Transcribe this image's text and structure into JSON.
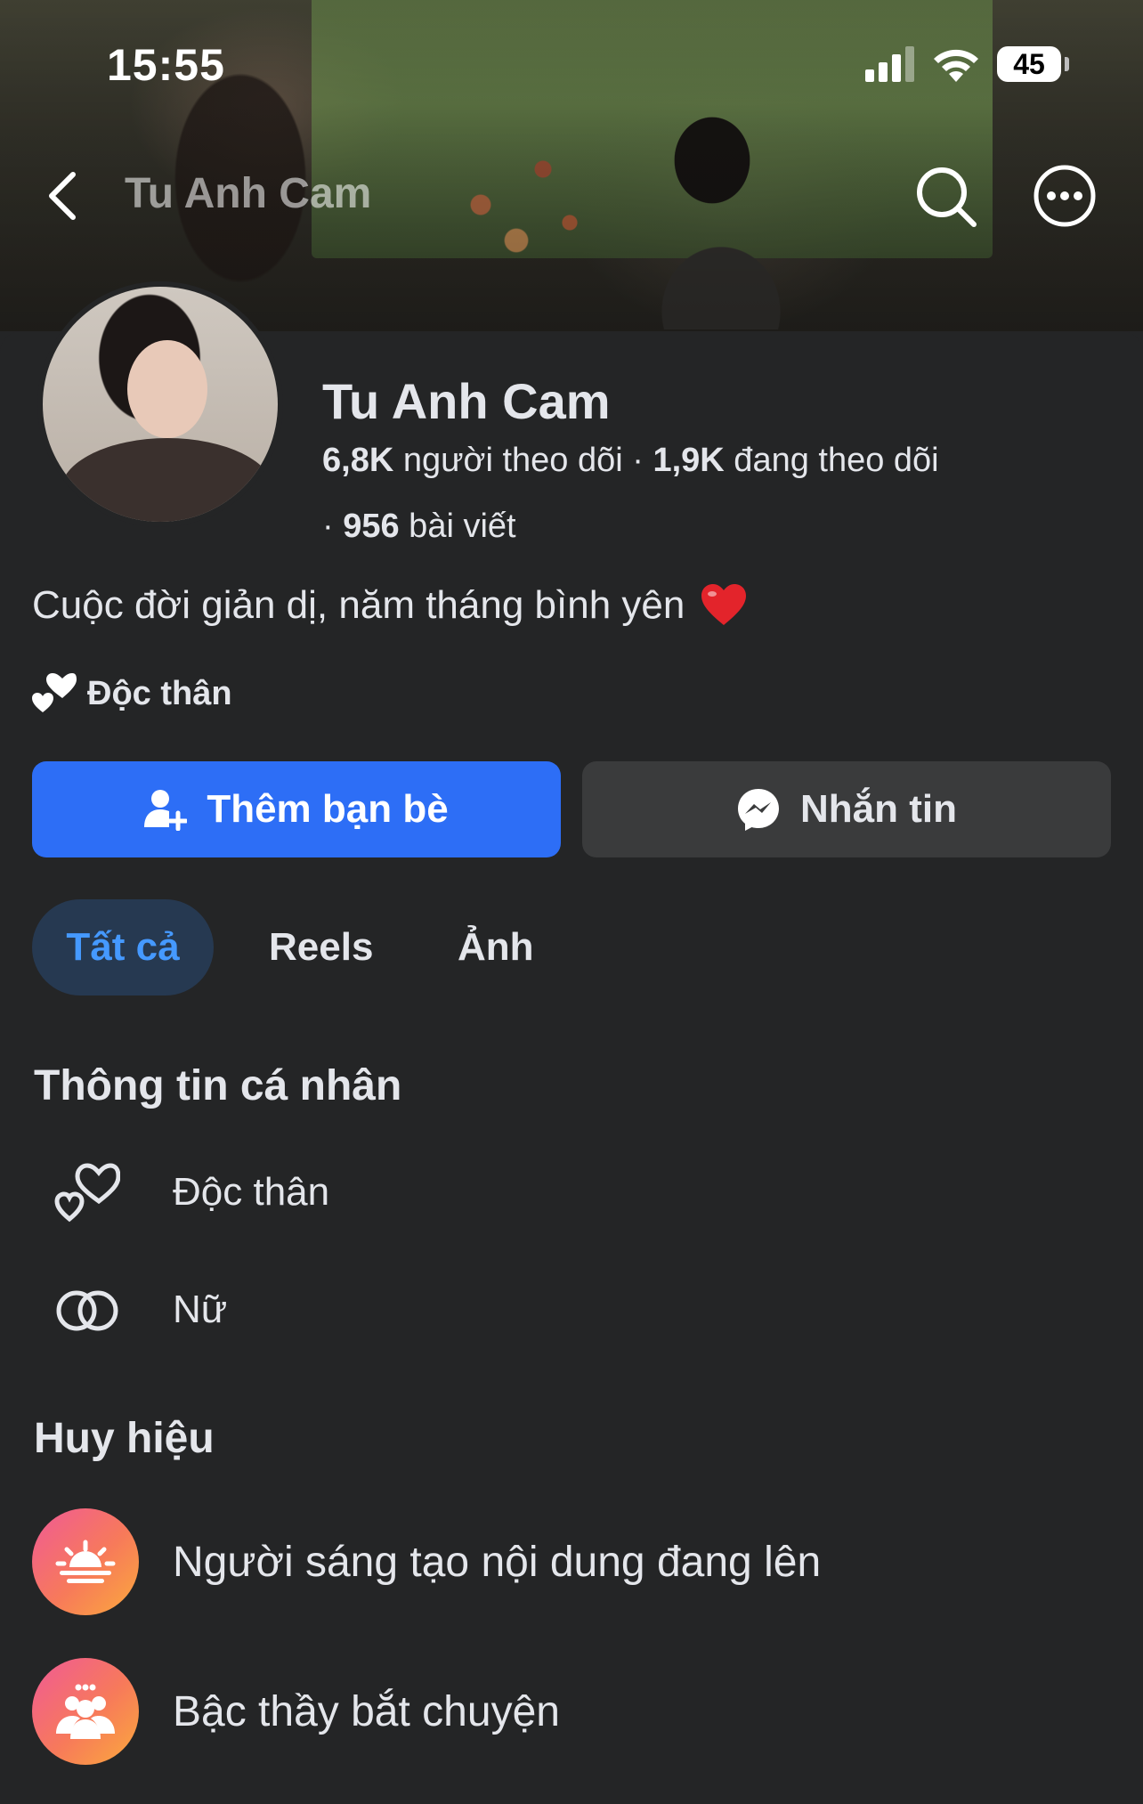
{
  "status_bar": {
    "time": "15:55",
    "battery": "45"
  },
  "nav": {
    "title": "Tu Anh Cam"
  },
  "profile": {
    "name": "Tu Anh Cam",
    "followers_count": "6,8K",
    "followers_label": " người theo dõi · ",
    "following_count": "1,9K",
    "following_label": " đang theo dõi",
    "posts_prefix": "· ",
    "posts_count": "956",
    "posts_label": " bài viết",
    "bio": "Cuộc đời giản dị, năm tháng bình yên",
    "relationship": "Độc thân"
  },
  "actions": {
    "add_friend": "Thêm bạn bè",
    "message": "Nhắn tin"
  },
  "tabs": [
    {
      "label": "Tất cả",
      "active": true
    },
    {
      "label": "Reels",
      "active": false
    },
    {
      "label": "Ảnh",
      "active": false
    }
  ],
  "personal_info": {
    "title": "Thông tin cá nhân",
    "items": [
      {
        "icon": "hearts-icon",
        "text": "Độc thân"
      },
      {
        "icon": "gender-icon",
        "text": "Nữ"
      }
    ]
  },
  "badges": {
    "title": "Huy hiệu",
    "items": [
      {
        "icon": "sunrise-icon",
        "text": "Người sáng tạo nội dung đang lên"
      },
      {
        "icon": "group-chat-icon",
        "text": "Bậc thầy bắt chuyện"
      }
    ]
  },
  "colors": {
    "accent": "#2d6ef6",
    "tab_active_bg": "#263951",
    "tab_active_text": "#4599ff",
    "background": "#242526",
    "badge_gradient": [
      "#f05a96",
      "#fbaa3c"
    ]
  }
}
